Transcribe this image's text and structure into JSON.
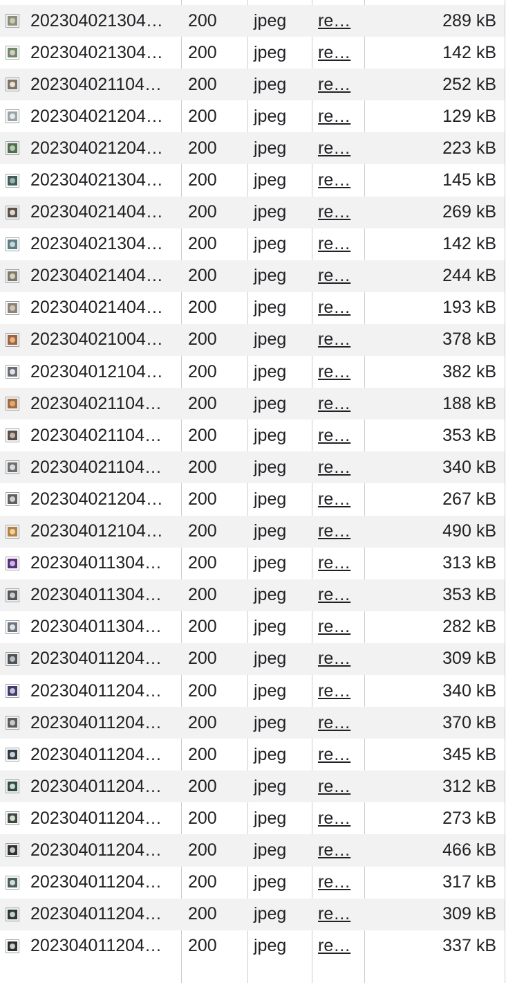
{
  "network": {
    "rows": [
      {
        "name": "202304021304…",
        "status": "200",
        "type": "jpeg",
        "initiator": "re…",
        "size": "289 kB",
        "thumb": "image-thumbnail-icon"
      },
      {
        "name": "202304021304…",
        "status": "200",
        "type": "jpeg",
        "initiator": "re…",
        "size": "142 kB",
        "thumb": "image-thumbnail-icon"
      },
      {
        "name": "202304021104…",
        "status": "200",
        "type": "jpeg",
        "initiator": "re…",
        "size": "252 kB",
        "thumb": "image-thumbnail-icon"
      },
      {
        "name": "202304021204…",
        "status": "200",
        "type": "jpeg",
        "initiator": "re…",
        "size": "129 kB",
        "thumb": "image-thumbnail-icon"
      },
      {
        "name": "202304021204…",
        "status": "200",
        "type": "jpeg",
        "initiator": "re…",
        "size": "223 kB",
        "thumb": "image-thumbnail-icon"
      },
      {
        "name": "202304021304…",
        "status": "200",
        "type": "jpeg",
        "initiator": "re…",
        "size": "145 kB",
        "thumb": "image-thumbnail-icon"
      },
      {
        "name": "202304021404…",
        "status": "200",
        "type": "jpeg",
        "initiator": "re…",
        "size": "269 kB",
        "thumb": "image-thumbnail-icon"
      },
      {
        "name": "202304021304…",
        "status": "200",
        "type": "jpeg",
        "initiator": "re…",
        "size": "142 kB",
        "thumb": "image-thumbnail-icon"
      },
      {
        "name": "202304021404…",
        "status": "200",
        "type": "jpeg",
        "initiator": "re…",
        "size": "244 kB",
        "thumb": "image-thumbnail-icon"
      },
      {
        "name": "202304021404…",
        "status": "200",
        "type": "jpeg",
        "initiator": "re…",
        "size": "193 kB",
        "thumb": "image-thumbnail-icon"
      },
      {
        "name": "202304021004…",
        "status": "200",
        "type": "jpeg",
        "initiator": "re…",
        "size": "378 kB",
        "thumb": "image-thumbnail-icon"
      },
      {
        "name": "202304012104…",
        "status": "200",
        "type": "jpeg",
        "initiator": "re…",
        "size": "382 kB",
        "thumb": "image-thumbnail-icon"
      },
      {
        "name": "202304021104…",
        "status": "200",
        "type": "jpeg",
        "initiator": "re…",
        "size": "188 kB",
        "thumb": "image-thumbnail-icon"
      },
      {
        "name": "202304021104…",
        "status": "200",
        "type": "jpeg",
        "initiator": "re…",
        "size": "353 kB",
        "thumb": "image-thumbnail-icon"
      },
      {
        "name": "202304021104…",
        "status": "200",
        "type": "jpeg",
        "initiator": "re…",
        "size": "340 kB",
        "thumb": "image-thumbnail-icon"
      },
      {
        "name": "202304021204…",
        "status": "200",
        "type": "jpeg",
        "initiator": "re…",
        "size": "267 kB",
        "thumb": "image-thumbnail-icon"
      },
      {
        "name": "202304012104…",
        "status": "200",
        "type": "jpeg",
        "initiator": "re…",
        "size": "490 kB",
        "thumb": "image-thumbnail-icon"
      },
      {
        "name": "202304011304…",
        "status": "200",
        "type": "jpeg",
        "initiator": "re…",
        "size": "313 kB",
        "thumb": "image-thumbnail-icon"
      },
      {
        "name": "202304011304…",
        "status": "200",
        "type": "jpeg",
        "initiator": "re…",
        "size": "353 kB",
        "thumb": "image-thumbnail-icon"
      },
      {
        "name": "202304011304…",
        "status": "200",
        "type": "jpeg",
        "initiator": "re…",
        "size": "282 kB",
        "thumb": "image-thumbnail-icon"
      },
      {
        "name": "202304011204…",
        "status": "200",
        "type": "jpeg",
        "initiator": "re…",
        "size": "309 kB",
        "thumb": "image-thumbnail-icon"
      },
      {
        "name": "202304011204…",
        "status": "200",
        "type": "jpeg",
        "initiator": "re…",
        "size": "340 kB",
        "thumb": "image-thumbnail-icon"
      },
      {
        "name": "202304011204…",
        "status": "200",
        "type": "jpeg",
        "initiator": "re…",
        "size": "370 kB",
        "thumb": "image-thumbnail-icon"
      },
      {
        "name": "202304011204…",
        "status": "200",
        "type": "jpeg",
        "initiator": "re…",
        "size": "345 kB",
        "thumb": "image-thumbnail-icon"
      },
      {
        "name": "202304011204…",
        "status": "200",
        "type": "jpeg",
        "initiator": "re…",
        "size": "312 kB",
        "thumb": "image-thumbnail-icon"
      },
      {
        "name": "202304011204…",
        "status": "200",
        "type": "jpeg",
        "initiator": "re…",
        "size": "273 kB",
        "thumb": "image-thumbnail-icon"
      },
      {
        "name": "202304011204…",
        "status": "200",
        "type": "jpeg",
        "initiator": "re…",
        "size": "466 kB",
        "thumb": "image-thumbnail-icon"
      },
      {
        "name": "202304011204…",
        "status": "200",
        "type": "jpeg",
        "initiator": "re…",
        "size": "317 kB",
        "thumb": "image-thumbnail-icon"
      },
      {
        "name": "202304011204…",
        "status": "200",
        "type": "jpeg",
        "initiator": "re…",
        "size": "309 kB",
        "thumb": "image-thumbnail-icon"
      },
      {
        "name": "202304011204…",
        "status": "200",
        "type": "jpeg",
        "initiator": "re…",
        "size": "337 kB",
        "thumb": "image-thumbnail-icon"
      }
    ]
  },
  "colors": {
    "row_alt": "#f2f2f2",
    "column_divider": "#cbcbcb",
    "text": "#202124"
  }
}
